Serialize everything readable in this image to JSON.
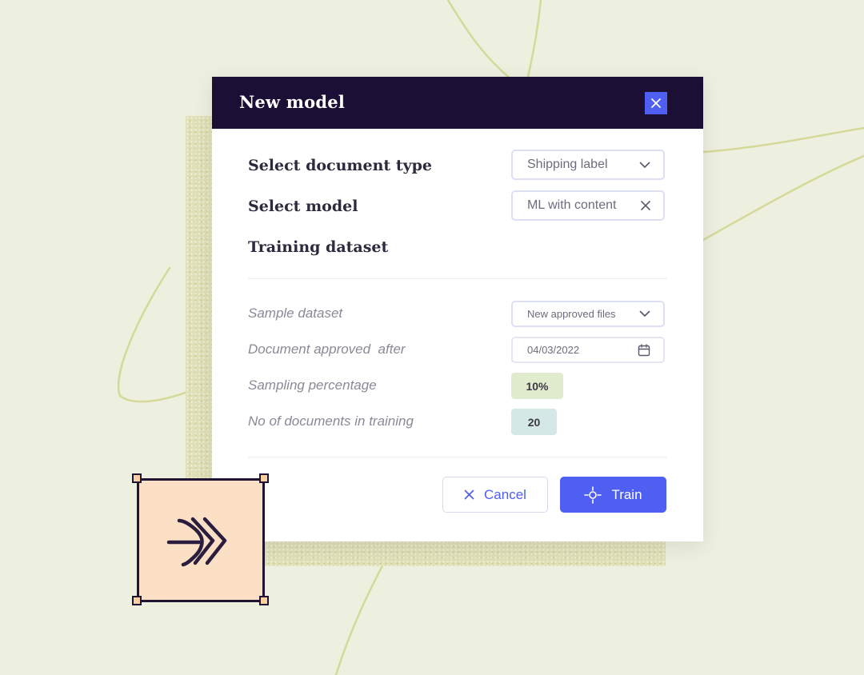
{
  "dialog": {
    "title": "New model",
    "document_type": {
      "label": "Select document type",
      "value": "Shipping label"
    },
    "model": {
      "label": "Select model",
      "value": "ML with content"
    },
    "training_dataset_label": "Training dataset",
    "sample_dataset": {
      "label": "Sample dataset",
      "value": "New approved files"
    },
    "approved_after": {
      "label": "Document approved  after",
      "value": "04/03/2022"
    },
    "sampling_percentage": {
      "label": "Sampling percentage",
      "value": "10%"
    },
    "documents_in_training": {
      "label": "No of documents in training",
      "value": "20"
    },
    "cancel_label": "Cancel",
    "train_label": "Train"
  },
  "colors": {
    "background": "#eef0df",
    "header": "#1c0f35",
    "accent": "#4e5ff2",
    "sampling_chip": "#e1ebcd",
    "count_chip": "#d4e8e6",
    "node_fill": "#fbe0c6"
  },
  "icons": {
    "close": "close-icon",
    "dropdown": "chevron-down-icon",
    "clear": "clear-x-icon",
    "calendar": "calendar-icon",
    "cancel": "x-icon",
    "train": "crosshair-icon",
    "node": "arrow-chevrons-icon"
  }
}
